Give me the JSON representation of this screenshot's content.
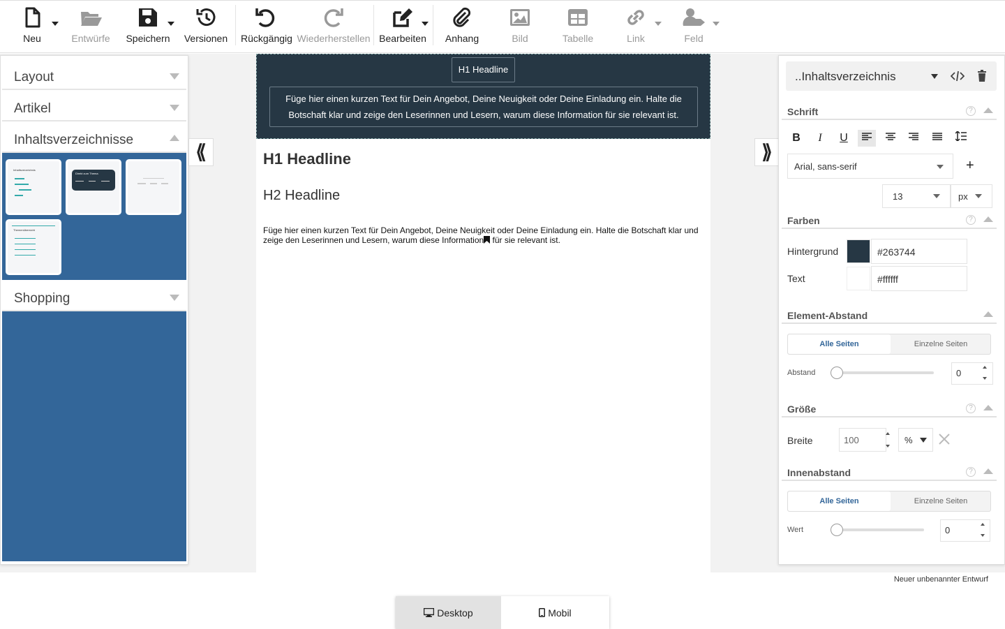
{
  "toolbar": {
    "new": "Neu",
    "drafts": "Entwürfe",
    "save": "Speichern",
    "versions": "Versionen",
    "undo": "Rückgängig",
    "redo": "Wiederherstellen",
    "edit": "Bearbeiten",
    "attachment": "Anhang",
    "image": "Bild",
    "table": "Tabelle",
    "link": "Link",
    "field": "Feld"
  },
  "left_panel": {
    "sections": [
      "Layout",
      "Artikel",
      "Inhaltsverzeichnisse",
      "Shopping"
    ],
    "thumbnails": [
      "Inhaltsverzeichnis",
      "Direkt zum Thema",
      "",
      "Themenübersicht"
    ]
  },
  "canvas": {
    "hero_tag": "H1 Headline",
    "hero_text": "Füge hier einen kurzen Text für Dein Angebot, Deine Neuigkeit oder Deine Einladung ein. Halte die Botschaft klar und zeige den Leserinnen und Lesern, warum diese Information für sie relevant ist.",
    "h1": "H1 Headline",
    "h2": "H2 Headline",
    "body_before": "Füge hier einen kurzen Text für Dein Angebot, Deine Neuigkeit oder Deine Einladung ein. Halte die Botschaft klar und zeige den Leserinnen und Lesern, warum diese Information",
    "body_after": " für sie relevant ist."
  },
  "right_panel": {
    "element_select": "..Inhaltsverzeichnis",
    "font_section": "Schrift",
    "format_buttons": [
      "B",
      "I",
      "U"
    ],
    "font_family": "Arial, sans-serif",
    "font_size": "13",
    "font_unit": "px",
    "colors_section": "Farben",
    "bg_label": "Hintergrund",
    "bg_value": "#263744",
    "bg_color": "#263744",
    "text_label": "Text",
    "text_value": "#ffffff",
    "text_color": "#ffffff",
    "spacing_section": "Element-Abstand",
    "all_sides": "Alle Seiten",
    "single_sides": "Einzelne Seiten",
    "spacing_label": "Abstand",
    "spacing_value": "0",
    "size_section": "Größe",
    "width_label": "Breite",
    "width_value": "100",
    "width_unit": "%",
    "padding_section": "Innenabstand",
    "padding_label": "Wert",
    "padding_value": "0"
  },
  "status": "Neuer unbenannter Entwurf",
  "device": {
    "desktop": "Desktop",
    "mobile": "Mobil"
  },
  "colors": {
    "accent": "#336699",
    "hero_bg": "#263744"
  }
}
